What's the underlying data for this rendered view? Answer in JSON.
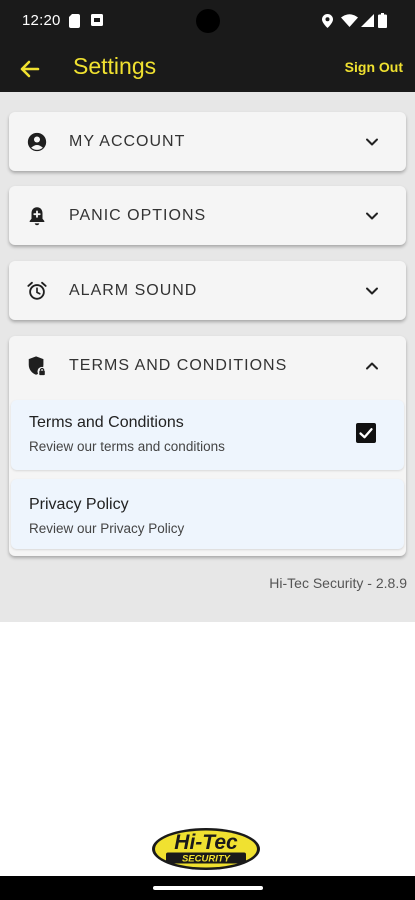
{
  "status_bar": {
    "time": "12:20",
    "icons": [
      "sim-card-icon",
      "notification-icon",
      "location-icon",
      "wifi-icon",
      "signal-icon",
      "battery-icon"
    ]
  },
  "app_bar": {
    "title": "Settings",
    "back_icon": "arrow-left-icon",
    "sign_out_label": "Sign Out",
    "accent_color": "#f0e130",
    "background_color": "#1a1a1a"
  },
  "sections": [
    {
      "label": "MY ACCOUNT",
      "icon": "account-circle-icon",
      "expanded": false
    },
    {
      "label": "PANIC OPTIONS",
      "icon": "panic-alarm-icon",
      "expanded": false
    },
    {
      "label": "ALARM SOUND",
      "icon": "alarm-clock-icon",
      "expanded": false
    },
    {
      "label": "TERMS AND CONDITIONS",
      "icon": "shield-lock-icon",
      "expanded": true
    }
  ],
  "terms_items": [
    {
      "title": "Terms and Conditions",
      "description": "Review our terms and conditions",
      "checked": true
    },
    {
      "title": "Privacy Policy",
      "description": "Review our Privacy Policy"
    }
  ],
  "version": "Hi-Tec Security - 2.8.9",
  "logo": {
    "line1": "Hi-Tec",
    "line2": "SECURITY"
  }
}
